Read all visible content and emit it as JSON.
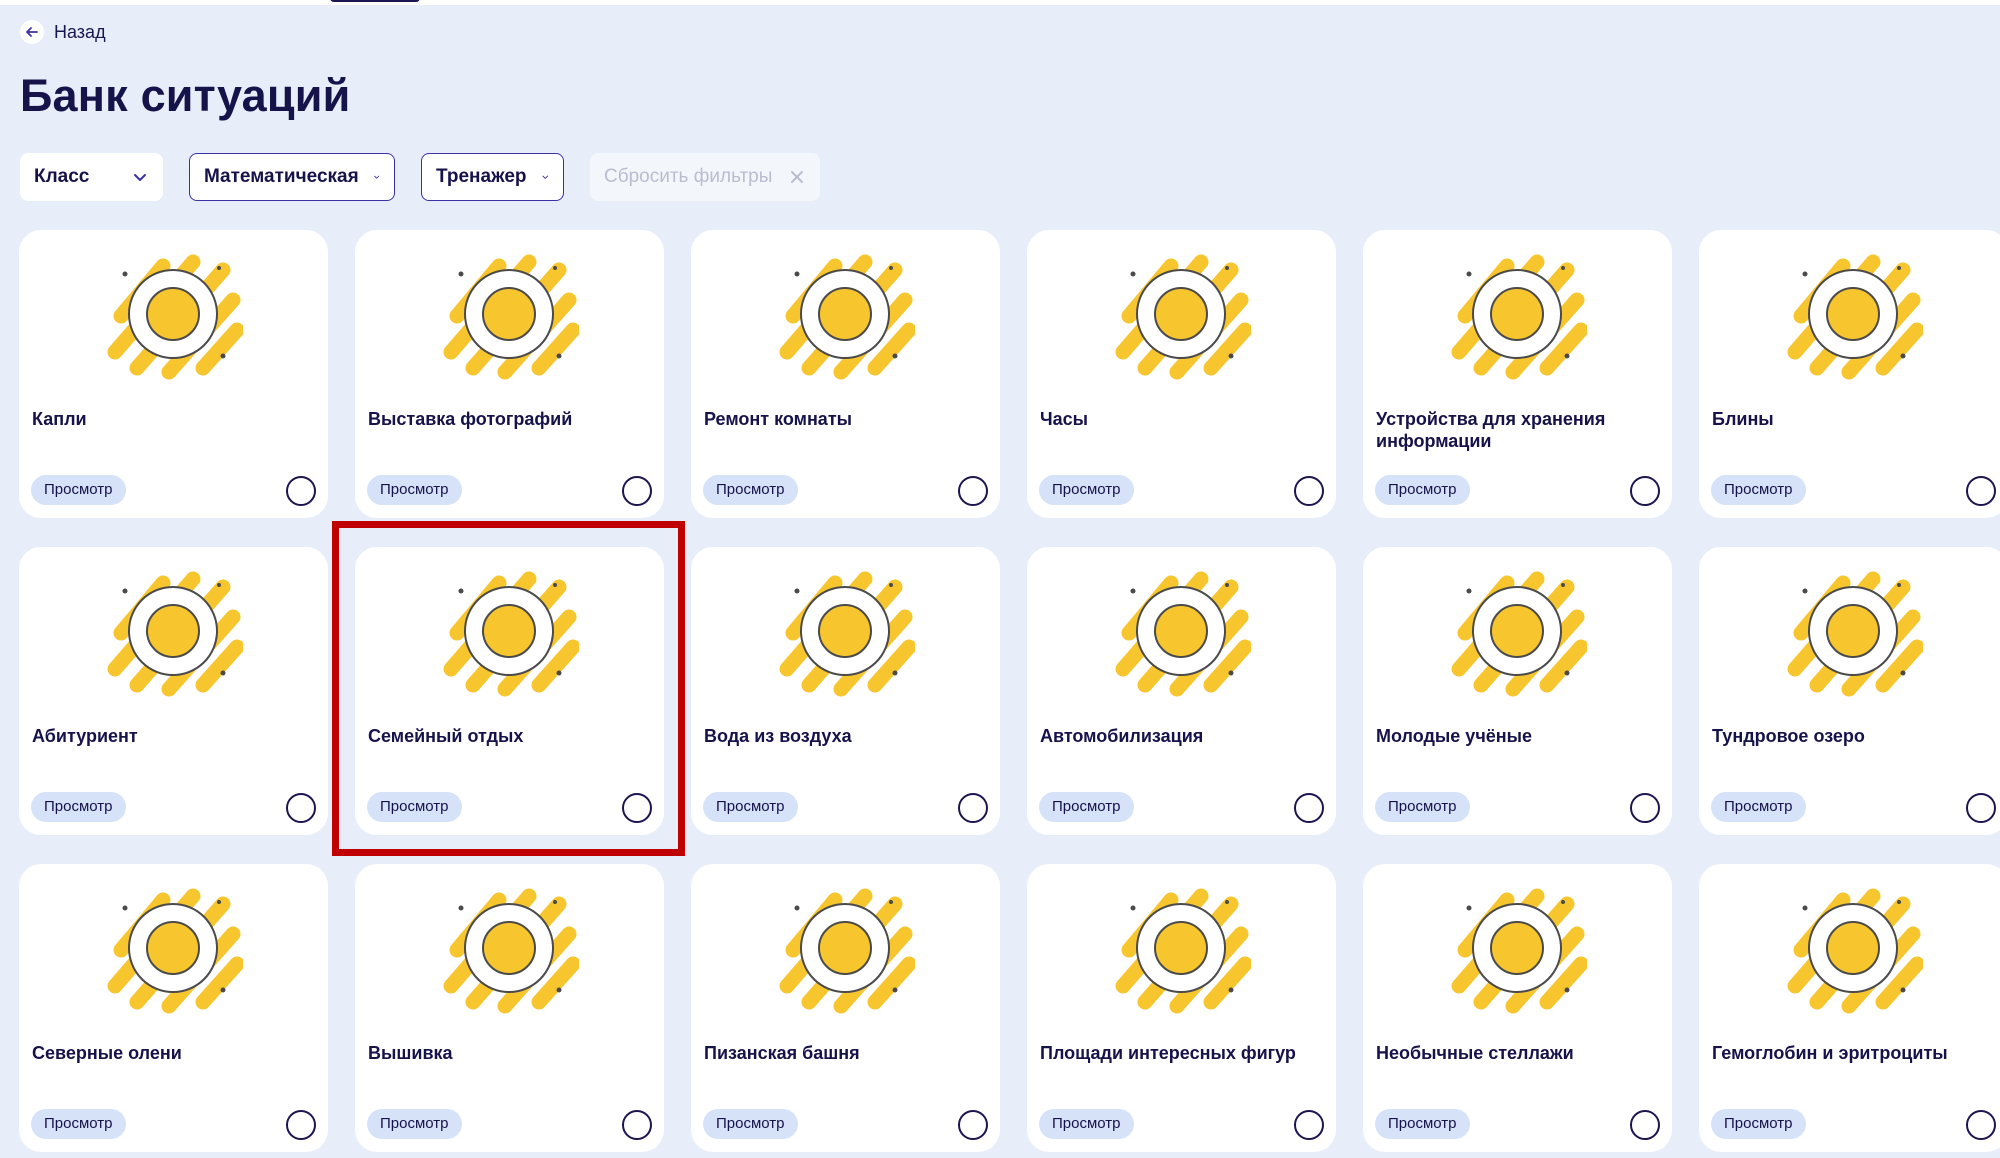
{
  "nav": {
    "back_label": "Назад"
  },
  "page": {
    "title": "Банк ситуаций"
  },
  "filters": {
    "grade": "Класс",
    "literacy": "Математическая",
    "mode": "Тренажер",
    "reset": "Сбросить фильтры"
  },
  "colors": {
    "accent": "#3d2fa6",
    "yellow": "#f7c52e",
    "highlight": "#c00000",
    "pill": "#d6e2f8"
  },
  "cards": [
    {
      "title": "Капли",
      "view": "Просмотр",
      "icon": "water-drop-icon"
    },
    {
      "title": "Выставка фотографий",
      "view": "Просмотр",
      "icon": "photo-frames-icon"
    },
    {
      "title": "Ремонт комнаты",
      "view": "Просмотр",
      "icon": "room-repair-icon"
    },
    {
      "title": "Часы",
      "view": "Просмотр",
      "icon": "clock-icon"
    },
    {
      "title": "Устройства для хранения информации",
      "view": "Просмотр",
      "icon": "storage-devices-icon"
    },
    {
      "title": "Блины",
      "view": "Просмотр",
      "icon": "pancakes-icon"
    },
    {
      "title": "Абитуриент",
      "view": "Просмотр",
      "icon": "graduate-icon"
    },
    {
      "title": "Семейный отдых",
      "view": "Просмотр",
      "icon": "family-icon"
    },
    {
      "title": "Вода из воздуха",
      "view": "Просмотр",
      "icon": "air-water-icon"
    },
    {
      "title": "Автомобилизация",
      "view": "Просмотр",
      "icon": "car-icon"
    },
    {
      "title": "Молодые учёные",
      "view": "Просмотр",
      "icon": "scientists-icon"
    },
    {
      "title": "Тундровое озеро",
      "view": "Просмотр",
      "icon": "tundra-lake-icon"
    },
    {
      "title": "Северные олени",
      "view": "Просмотр",
      "icon": "reindeer-icon"
    },
    {
      "title": "Вышивка",
      "view": "Просмотр",
      "icon": "embroidery-hoop-icon"
    },
    {
      "title": "Пизанская башня",
      "view": "Просмотр",
      "icon": "pisa-tower-icon"
    },
    {
      "title": "Площади интересных фигур",
      "view": "Просмотр",
      "icon": "flower-shape-icon"
    },
    {
      "title": "Необычные стеллажи",
      "view": "Просмотр",
      "icon": "shelves-icon"
    },
    {
      "title": "Гемоглобин и эритроциты",
      "view": "Просмотр",
      "icon": "blood-cells-icon"
    }
  ]
}
